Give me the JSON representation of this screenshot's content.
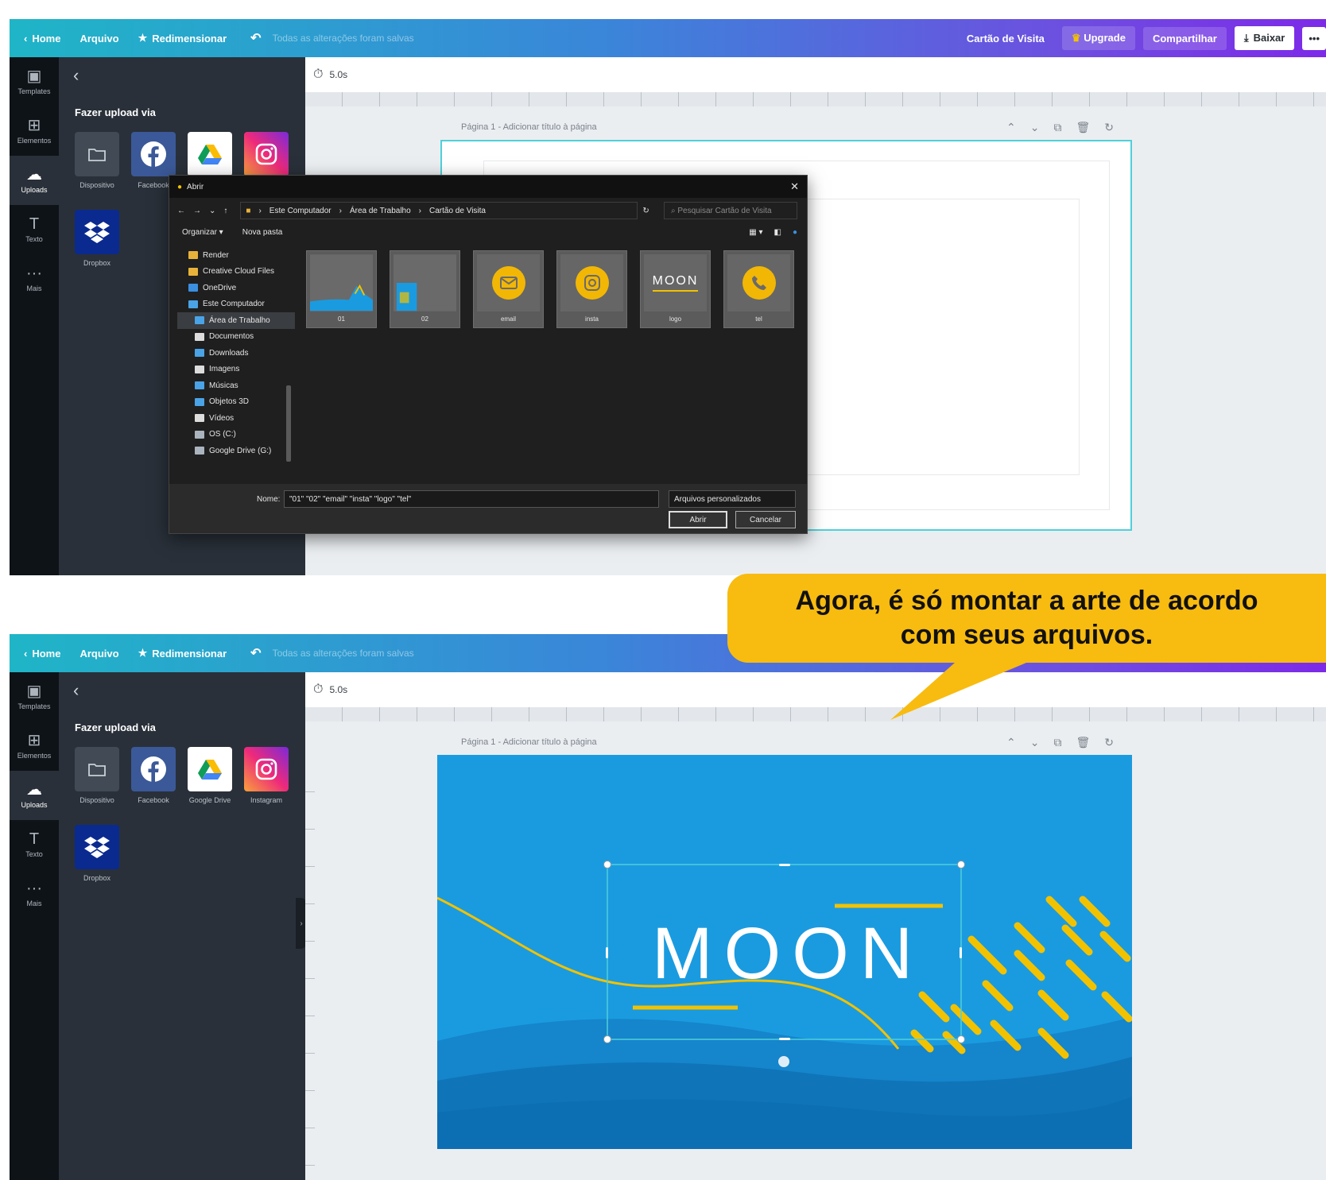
{
  "topbar": {
    "home": "Home",
    "file": "Arquivo",
    "resize": "Redimensionar",
    "save_status": "Todas as alterações foram salvas",
    "design_name": "Cartão de Visita",
    "upgrade": "Upgrade",
    "share": "Compartilhar",
    "download": "Baixar",
    "more": "•••"
  },
  "leftnav": {
    "items": [
      {
        "label": "Templates",
        "icon": "template-icon"
      },
      {
        "label": "Elementos",
        "icon": "elements-icon"
      },
      {
        "label": "Uploads",
        "icon": "cloud-upload-icon"
      },
      {
        "label": "Texto",
        "icon": "text-icon"
      },
      {
        "label": "Mais",
        "icon": "more-icon"
      }
    ]
  },
  "panel": {
    "title": "Fazer upload via",
    "sources": [
      {
        "label": "Dispositivo",
        "icon": "folder-icon"
      },
      {
        "label": "Facebook",
        "icon": "facebook-icon"
      },
      {
        "label": "Google Drive",
        "icon": "google-drive-icon"
      },
      {
        "label": "Instagram",
        "icon": "instagram-icon"
      },
      {
        "label": "Dropbox",
        "icon": "dropbox-icon"
      }
    ]
  },
  "canvas": {
    "timer": "5.0s",
    "page_label": "Página 1 - Adicionar título à página"
  },
  "dialog": {
    "title": "Abrir",
    "path": [
      "Este Computador",
      "Área de Trabalho",
      "Cartão de Visita"
    ],
    "search_placeholder": "Pesquisar Cartão de Visita",
    "organize": "Organizar ▾",
    "new_folder": "Nova pasta",
    "tree": [
      {
        "label": "Render",
        "sub": false,
        "color": "#e8b23a"
      },
      {
        "label": "Creative Cloud Files",
        "sub": false,
        "color": "#e8b23a"
      },
      {
        "label": "OneDrive",
        "sub": false,
        "color": "#3b8fe0"
      },
      {
        "label": "Este Computador",
        "sub": false,
        "color": "#4aa3e6"
      },
      {
        "label": "Área de Trabalho",
        "sub": true,
        "color": "#4aa3e6",
        "selected": true
      },
      {
        "label": "Documentos",
        "sub": true,
        "color": "#dcdcdc"
      },
      {
        "label": "Downloads",
        "sub": true,
        "color": "#4aa3e6"
      },
      {
        "label": "Imagens",
        "sub": true,
        "color": "#dcdcdc"
      },
      {
        "label": "Músicas",
        "sub": true,
        "color": "#4aa3e6"
      },
      {
        "label": "Objetos 3D",
        "sub": true,
        "color": "#4aa3e6"
      },
      {
        "label": "Vídeos",
        "sub": true,
        "color": "#dcdcdc"
      },
      {
        "label": "OS (C:)",
        "sub": true,
        "color": "#aab4be"
      },
      {
        "label": "Google Drive (G:)",
        "sub": true,
        "color": "#aab4be"
      }
    ],
    "files": [
      "01",
      "02",
      "email",
      "insta",
      "logo",
      "tel"
    ],
    "name_label": "Nome:",
    "name_value": "\"01\" \"02\" \"email\" \"insta\" \"logo\" \"tel\"",
    "type_value": "Arquivos personalizados",
    "open": "Abrir",
    "cancel": "Cancelar"
  },
  "design": {
    "logo_text": "MOON",
    "colors": {
      "sky": "#1a9be0",
      "accent": "#f2c200",
      "wave_dark": "#0d6fb3"
    }
  },
  "callout": {
    "line1": "Agora, é só montar a arte de acordo",
    "line2": "com seus arquivos."
  }
}
